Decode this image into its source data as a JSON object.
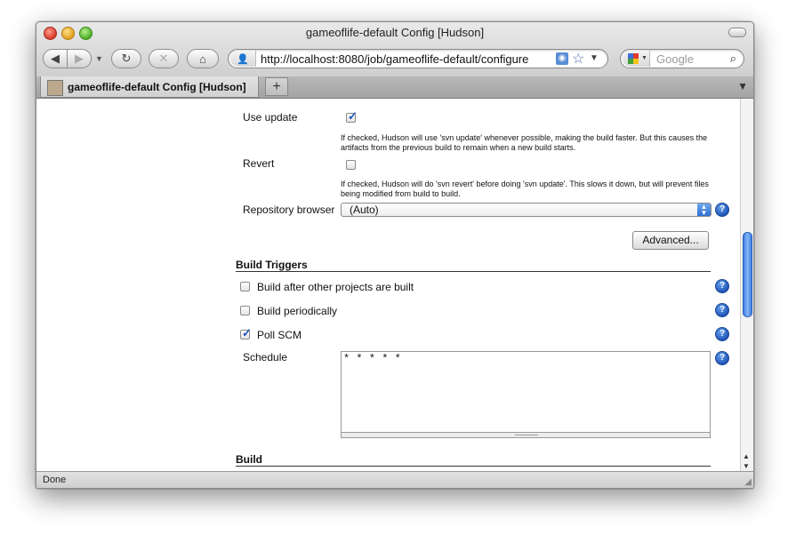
{
  "window": {
    "title": "gameoflife-default Config [Hudson]"
  },
  "toolbar": {
    "url": "http://localhost:8080/job/gameoflife-default/configure",
    "search_placeholder": "Google"
  },
  "tab": {
    "label": "gameoflife-default Config [Hudson]",
    "new_tab_label": "+"
  },
  "form": {
    "use_update": {
      "label": "Use update",
      "checked": true,
      "help": "If checked, Hudson will use 'svn update' whenever possible, making the build faster. But this causes the artifacts from the previous build to remain when a new build starts."
    },
    "revert": {
      "label": "Revert",
      "checked": false,
      "help": "If checked, Hudson will do 'svn revert' before doing 'svn update'. This slows it down, but will prevent files being modified from build to build."
    },
    "repository_browser": {
      "label": "Repository browser",
      "value": "(Auto)"
    },
    "advanced_button": "Advanced...",
    "build_triggers": {
      "title": "Build Triggers",
      "items": [
        {
          "label": "Build after other projects are built",
          "checked": false
        },
        {
          "label": "Build periodically",
          "checked": false
        },
        {
          "label": "Poll SCM",
          "checked": true
        }
      ],
      "schedule": {
        "label": "Schedule",
        "value": "* * * * *"
      }
    },
    "build": {
      "title": "Build"
    }
  },
  "status": {
    "text": "Done"
  }
}
